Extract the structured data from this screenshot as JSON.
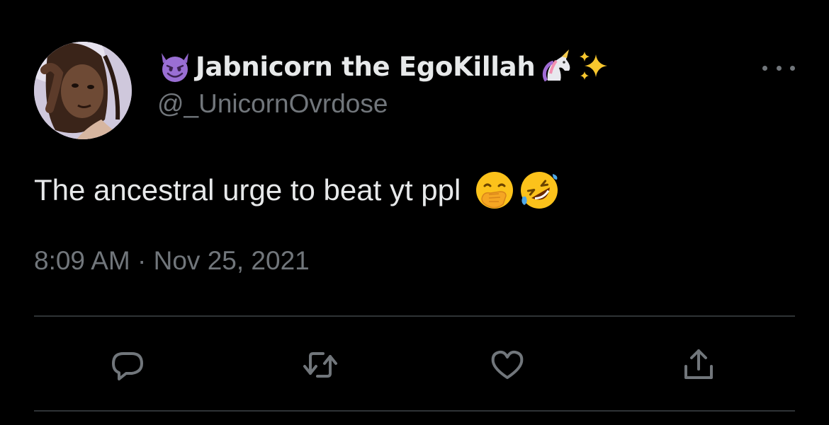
{
  "user": {
    "display_name": "Jabnicorn the EgoKillah",
    "handle": "@_UnicornOvrdose",
    "name_emojis": [
      "smiling-devil-icon",
      "unicorn-icon",
      "sparkles-icon"
    ]
  },
  "tweet": {
    "text": "The ancestral urge to beat yt ppl",
    "text_emojis": [
      "hand-over-mouth-icon",
      "rolling-on-floor-laughing-icon"
    ],
    "timestamp": "8:09 AM · Nov 25, 2021"
  },
  "actions": [
    "reply-icon",
    "retweet-icon",
    "like-icon",
    "share-icon"
  ],
  "colors": {
    "background": "#000000",
    "primary_text": "#e7e9ea",
    "secondary_text": "#71767b",
    "divider": "#2f3336"
  }
}
